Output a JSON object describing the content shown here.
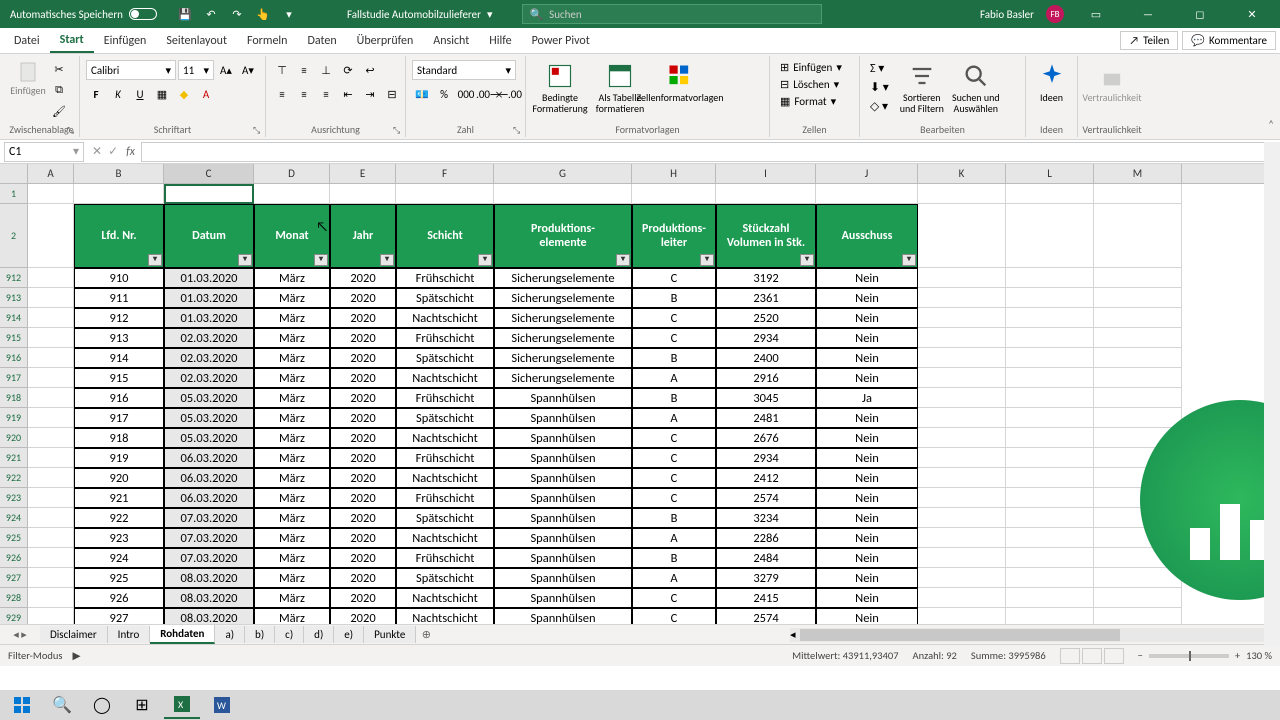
{
  "title": {
    "autosave": "Automatisches Speichern",
    "filename": "Fallstudie Automobilzulieferer",
    "search_ph": "Suchen",
    "user": "Fabio Basler",
    "initials": "FB"
  },
  "tabs": {
    "t0": "Datei",
    "t1": "Start",
    "t2": "Einfügen",
    "t3": "Seitenlayout",
    "t4": "Formeln",
    "t5": "Daten",
    "t6": "Überprüfen",
    "t7": "Ansicht",
    "t8": "Hilfe",
    "t9": "Power Pivot",
    "share": "Teilen",
    "comments": "Kommentare"
  },
  "ribbon": {
    "clipboard": "Zwischenablage",
    "paste": "Einfügen",
    "font": "Schriftart",
    "fontname": "Calibri",
    "fontsize": "11",
    "align": "Ausrichtung",
    "number": "Zahl",
    "numfmt": "Standard",
    "styles": "Formatvorlagen",
    "cond": "Bedingte Formatierung",
    "astable": "Als Tabelle formatieren",
    "cellstyles": "Zellenformatvorlagen",
    "cells": "Zellen",
    "insert": "Einfügen",
    "delete": "Löschen",
    "format": "Format",
    "editing": "Bearbeiten",
    "sortfilter": "Sortieren und Filtern",
    "findsel": "Suchen und Auswählen",
    "ideas": "Ideen",
    "ideas2": "Ideen",
    "sens": "Vertraulichkeit",
    "sens2": "Vertraulichkeit"
  },
  "namebox": "C1",
  "cols": {
    "A": "A",
    "B": "B",
    "C": "C",
    "D": "D",
    "E": "E",
    "F": "F",
    "G": "G",
    "H": "H",
    "I": "I",
    "J": "J",
    "K": "K",
    "L": "L",
    "M": "M"
  },
  "headers": {
    "b": "Lfd. Nr.",
    "c": "Datum",
    "d": "Monat",
    "e": "Jahr",
    "f": "Schicht",
    "g": "Produktions-\nelemente",
    "h": "Produktions-\nleiter",
    "i": "Stückzahl Volumen in Stk.",
    "j": "Ausschuss"
  },
  "rownums1": "1",
  "rownums2": "2",
  "data_rows": [
    {
      "rn": "912",
      "b": "910",
      "c": "01.03.2020",
      "d": "März",
      "e": "2020",
      "f": "Frühschicht",
      "g": "Sicherungselemente",
      "h": "C",
      "i": "3192",
      "j": "Nein"
    },
    {
      "rn": "913",
      "b": "911",
      "c": "01.03.2020",
      "d": "März",
      "e": "2020",
      "f": "Spätschicht",
      "g": "Sicherungselemente",
      "h": "B",
      "i": "2361",
      "j": "Nein"
    },
    {
      "rn": "914",
      "b": "912",
      "c": "01.03.2020",
      "d": "März",
      "e": "2020",
      "f": "Nachtschicht",
      "g": "Sicherungselemente",
      "h": "C",
      "i": "2520",
      "j": "Nein"
    },
    {
      "rn": "915",
      "b": "913",
      "c": "02.03.2020",
      "d": "März",
      "e": "2020",
      "f": "Frühschicht",
      "g": "Sicherungselemente",
      "h": "C",
      "i": "2934",
      "j": "Nein"
    },
    {
      "rn": "916",
      "b": "914",
      "c": "02.03.2020",
      "d": "März",
      "e": "2020",
      "f": "Spätschicht",
      "g": "Sicherungselemente",
      "h": "B",
      "i": "2400",
      "j": "Nein"
    },
    {
      "rn": "917",
      "b": "915",
      "c": "02.03.2020",
      "d": "März",
      "e": "2020",
      "f": "Nachtschicht",
      "g": "Sicherungselemente",
      "h": "A",
      "i": "2916",
      "j": "Nein"
    },
    {
      "rn": "918",
      "b": "916",
      "c": "05.03.2020",
      "d": "März",
      "e": "2020",
      "f": "Frühschicht",
      "g": "Spannhülsen",
      "h": "B",
      "i": "3045",
      "j": "Ja"
    },
    {
      "rn": "919",
      "b": "917",
      "c": "05.03.2020",
      "d": "März",
      "e": "2020",
      "f": "Spätschicht",
      "g": "Spannhülsen",
      "h": "A",
      "i": "2481",
      "j": "Nein"
    },
    {
      "rn": "920",
      "b": "918",
      "c": "05.03.2020",
      "d": "März",
      "e": "2020",
      "f": "Nachtschicht",
      "g": "Spannhülsen",
      "h": "C",
      "i": "2676",
      "j": "Nein"
    },
    {
      "rn": "921",
      "b": "919",
      "c": "06.03.2020",
      "d": "März",
      "e": "2020",
      "f": "Frühschicht",
      "g": "Spannhülsen",
      "h": "C",
      "i": "2934",
      "j": "Nein"
    },
    {
      "rn": "922",
      "b": "920",
      "c": "06.03.2020",
      "d": "März",
      "e": "2020",
      "f": "Nachtschicht",
      "g": "Spannhülsen",
      "h": "C",
      "i": "2412",
      "j": "Nein"
    },
    {
      "rn": "923",
      "b": "921",
      "c": "06.03.2020",
      "d": "März",
      "e": "2020",
      "f": "Frühschicht",
      "g": "Spannhülsen",
      "h": "C",
      "i": "2574",
      "j": "Nein"
    },
    {
      "rn": "924",
      "b": "922",
      "c": "07.03.2020",
      "d": "März",
      "e": "2020",
      "f": "Spätschicht",
      "g": "Spannhülsen",
      "h": "B",
      "i": "3234",
      "j": "Nein"
    },
    {
      "rn": "925",
      "b": "923",
      "c": "07.03.2020",
      "d": "März",
      "e": "2020",
      "f": "Nachtschicht",
      "g": "Spannhülsen",
      "h": "A",
      "i": "2286",
      "j": "Nein"
    },
    {
      "rn": "926",
      "b": "924",
      "c": "07.03.2020",
      "d": "März",
      "e": "2020",
      "f": "Frühschicht",
      "g": "Spannhülsen",
      "h": "B",
      "i": "2484",
      "j": "Nein"
    },
    {
      "rn": "927",
      "b": "925",
      "c": "08.03.2020",
      "d": "März",
      "e": "2020",
      "f": "Spätschicht",
      "g": "Spannhülsen",
      "h": "A",
      "i": "3279",
      "j": "Nein"
    },
    {
      "rn": "928",
      "b": "926",
      "c": "08.03.2020",
      "d": "März",
      "e": "2020",
      "f": "Nachtschicht",
      "g": "Spannhülsen",
      "h": "C",
      "i": "2415",
      "j": "Nein"
    },
    {
      "rn": "929",
      "b": "927",
      "c": "08.03.2020",
      "d": "März",
      "e": "2020",
      "f": "Nachtschicht",
      "g": "Spannhülsen",
      "h": "C",
      "i": "2574",
      "j": "Nein"
    }
  ],
  "sheets": {
    "s0": "Disclaimer",
    "s1": "Intro",
    "s2": "Rohdaten",
    "s3": "a)",
    "s4": "b)",
    "s5": "c)",
    "s6": "d)",
    "s7": "e)",
    "s8": "Punkte"
  },
  "status": {
    "mode": "Filter-Modus",
    "avg": "Mittelwert: 43911,93407",
    "count": "Anzahl: 92",
    "sum": "Summe: 3995986",
    "zoom": "130 %"
  }
}
